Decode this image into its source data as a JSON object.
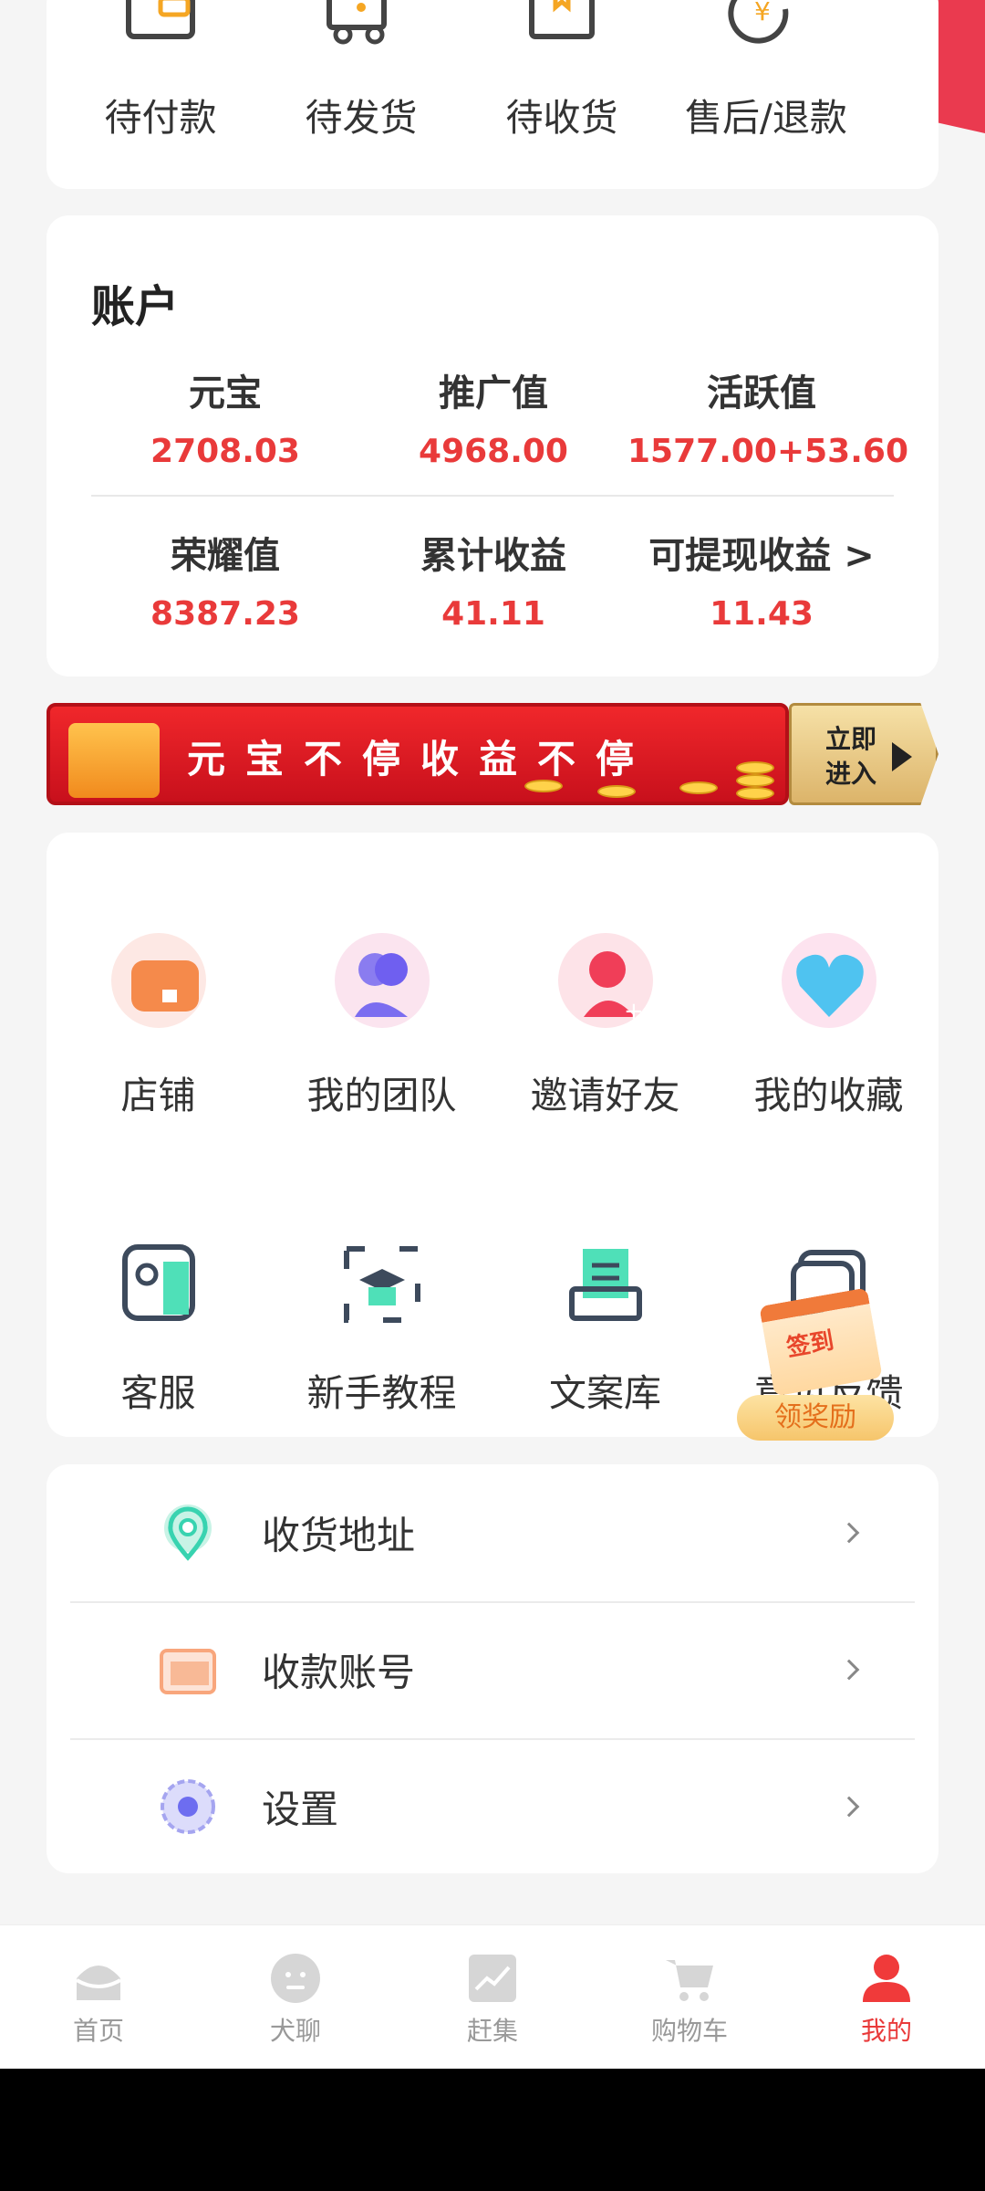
{
  "orders": [
    {
      "label": "待付款",
      "icon": "wallet-icon"
    },
    {
      "label": "待发货",
      "icon": "truck-icon"
    },
    {
      "label": "待收货",
      "icon": "package-icon"
    },
    {
      "label": "售后/退款",
      "icon": "yuan-refund-icon"
    }
  ],
  "account": {
    "title": "账户",
    "stats": [
      {
        "key": "元宝",
        "value": "2708.03"
      },
      {
        "key": "推广值",
        "value": "4968.00"
      },
      {
        "key": "活跃值",
        "value": "1577.00+53.60"
      },
      {
        "key": "荣耀值",
        "value": "8387.23"
      },
      {
        "key": "累计收益",
        "value": "41.11"
      },
      {
        "key": "可提现收益 >",
        "value": "11.43"
      }
    ]
  },
  "banner": {
    "slogan": "元宝不停收益不停",
    "enter": "立即进入"
  },
  "grid": [
    {
      "label": "店铺",
      "icon": "store-icon"
    },
    {
      "label": "我的团队",
      "icon": "team-icon"
    },
    {
      "label": "邀请好友",
      "icon": "invite-friend-icon"
    },
    {
      "label": "我的收藏",
      "icon": "heart-icon"
    },
    {
      "label": "客服",
      "icon": "customer-service-icon"
    },
    {
      "label": "新手教程",
      "icon": "tutorial-icon"
    },
    {
      "label": "文案库",
      "icon": "copywriting-icon"
    },
    {
      "label": "意见反馈",
      "icon": "feedback-icon"
    }
  ],
  "signin": {
    "badge": "签到",
    "reward": "领奖励"
  },
  "settings_list": [
    {
      "label": "收货地址",
      "icon": "location-pin-icon"
    },
    {
      "label": "收款账号",
      "icon": "card-icon"
    },
    {
      "label": "设置",
      "icon": "gear-icon"
    }
  ],
  "tabbar": [
    {
      "label": "首页",
      "icon": "home-icon"
    },
    {
      "label": "犬聊",
      "icon": "chat-face-icon"
    },
    {
      "label": "赶集",
      "icon": "market-chart-icon"
    },
    {
      "label": "购物车",
      "icon": "cart-icon"
    },
    {
      "label": "我的",
      "icon": "profile-icon",
      "active": true
    }
  ],
  "colors": {
    "accent": "#e93a3a",
    "background": "#f5f5f5"
  }
}
